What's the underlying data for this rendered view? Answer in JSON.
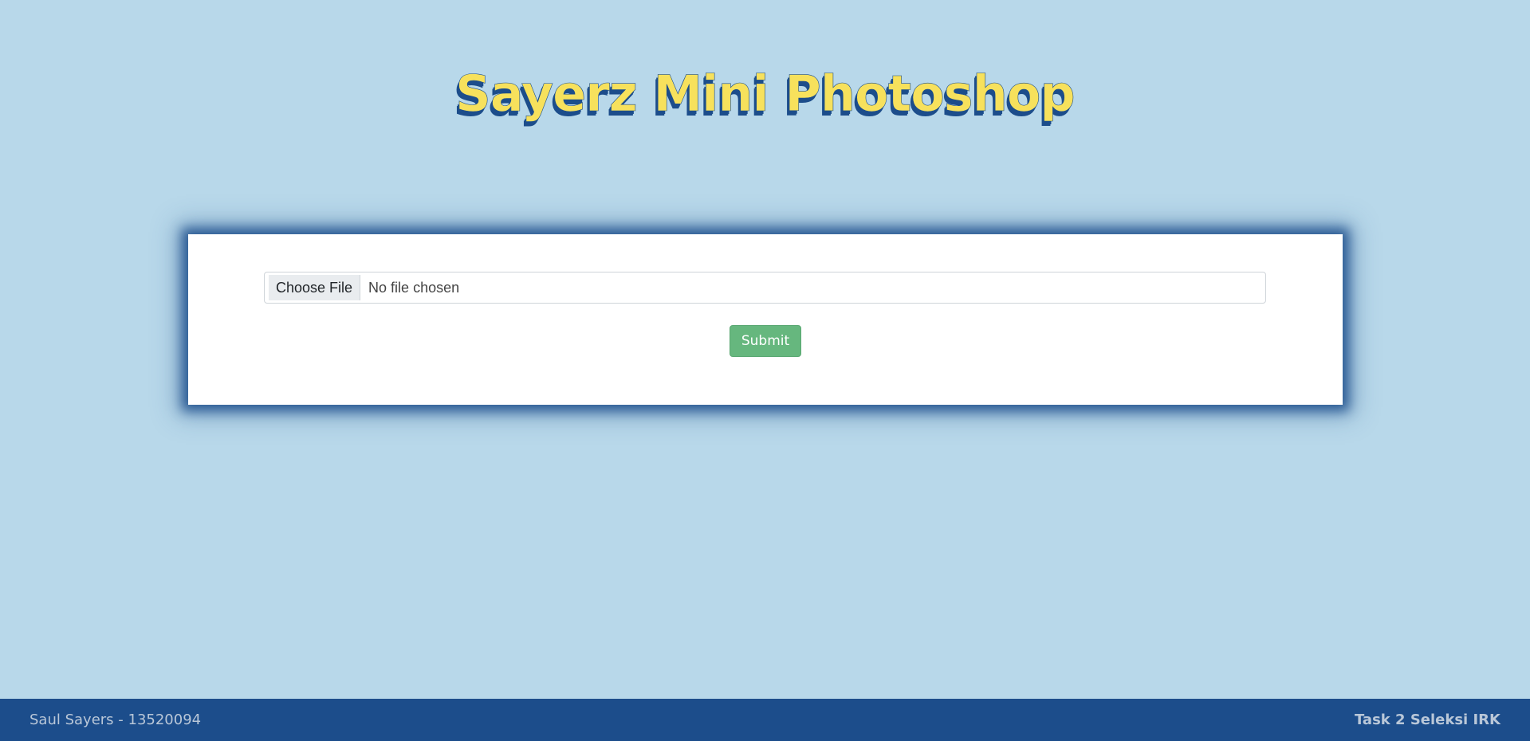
{
  "header": {
    "title": "Sayerz Mini Photoshop"
  },
  "upload_form": {
    "choose_file_label": "Choose File",
    "file_status": "No file chosen",
    "submit_label": "Submit"
  },
  "footer": {
    "left_text": "Saul Sayers - 13520094",
    "right_text": "Task 2 Seleksi IRK"
  },
  "colors": {
    "background": "#b8d8ea",
    "title_fill": "#f7e15c",
    "title_shadow": "#1c4d8b",
    "footer_bg": "#1c4d8b",
    "submit_bg": "#66b77e"
  }
}
